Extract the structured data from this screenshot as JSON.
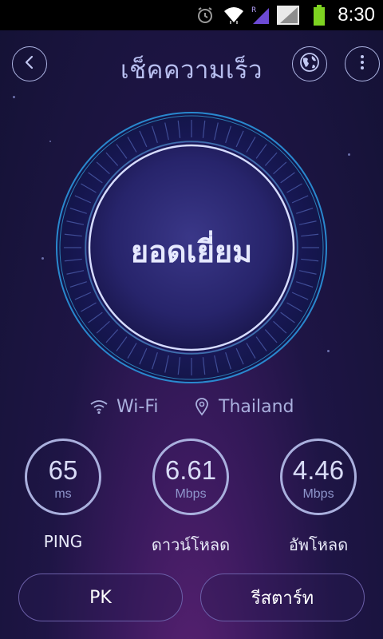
{
  "status_bar": {
    "time": "8:30",
    "icons": [
      "alarm-icon",
      "wifi-icon",
      "cell-signal-r-icon",
      "cell-signal-icon",
      "battery-icon"
    ],
    "battery_color": "#7ed321"
  },
  "header": {
    "title": "เช็คความเร็ว",
    "back_icon": "back-arrow-icon",
    "globe_icon": "globe-icon",
    "menu_icon": "more-vert-icon"
  },
  "dial": {
    "result": "ยอดเยี่ยม"
  },
  "network": {
    "type": "Wi-Fi",
    "location": "Thailand"
  },
  "stats": [
    {
      "value": "65",
      "unit": "ms",
      "label": "PING"
    },
    {
      "value": "6.61",
      "unit": "Mbps",
      "label": "ดาวน์โหลด"
    },
    {
      "value": "4.46",
      "unit": "Mbps",
      "label": "อัพโหลด"
    }
  ],
  "buttons": {
    "pk": "PK",
    "restart": "รีสตาร์ท"
  },
  "colors": {
    "accent": "#aab0de",
    "ring_glow": "#3ec7ff",
    "background": "#1e1545"
  }
}
